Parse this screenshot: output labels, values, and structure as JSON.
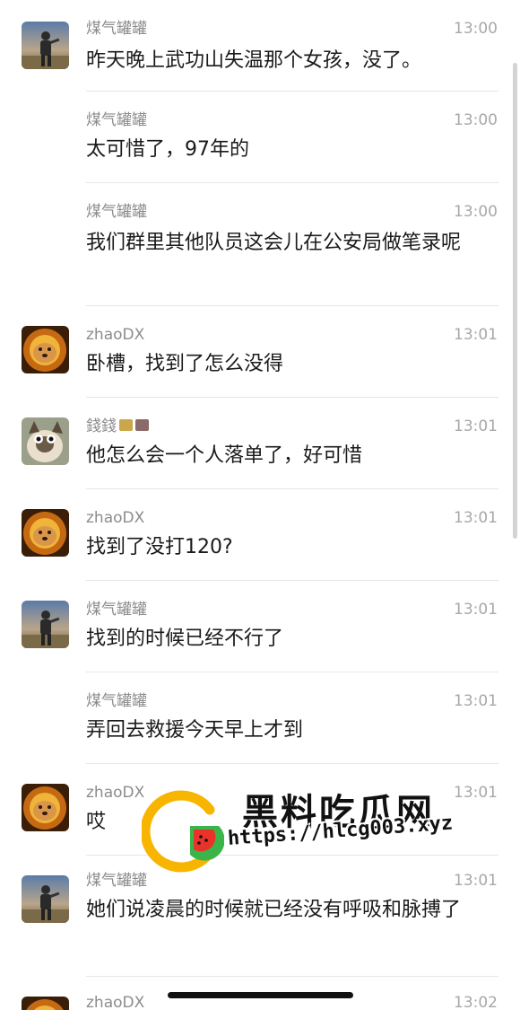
{
  "messages": [
    {
      "sender": "煤气罐罐",
      "time": "13:00",
      "text": "昨天晚上武功山失温那个女孩，没了。",
      "avatar": "hiker"
    },
    {
      "sender": "煤气罐罐",
      "time": "13:00",
      "text": "太可惜了，97年的",
      "avatar": ""
    },
    {
      "sender": "煤气罐罐",
      "time": "13:00",
      "text": "我们群里其他队员这会儿在公安局做笔录呢",
      "avatar": ""
    },
    {
      "sender": "zhaoDX",
      "time": "13:01",
      "text": "卧槽，找到了怎么没得",
      "avatar": "doge"
    },
    {
      "sender": "錢錢",
      "time": "13:01",
      "text": "他怎么会一个人落单了，好可惜",
      "avatar": "cat"
    },
    {
      "sender": "zhaoDX",
      "time": "13:01",
      "text": "找到了没打120?",
      "avatar": "doge"
    },
    {
      "sender": "煤气罐罐",
      "time": "13:01",
      "text": "找到的时候已经不行了",
      "avatar": "hiker"
    },
    {
      "sender": "煤气罐罐",
      "time": "13:01",
      "text": "弄回去救援今天早上才到",
      "avatar": ""
    },
    {
      "sender": "zhaoDX",
      "time": "13:01",
      "text": "哎",
      "avatar": "doge"
    },
    {
      "sender": "煤气罐罐",
      "time": "13:01",
      "text": "她们说凌晨的时候就已经没有呼吸和脉搏了",
      "avatar": "hiker"
    },
    {
      "sender": "zhaoDX",
      "time": "13:02",
      "text": "",
      "avatar": "doge"
    }
  ],
  "watermark": {
    "title": "黑料吃瓜网",
    "url": "https://hlcg003.xyz"
  },
  "colors": {
    "sender": "#8c8c8c",
    "time": "#a8a8a8",
    "text": "#1a1a1a",
    "divider": "#e6e6e6",
    "logo_orange": "#f7b500",
    "logo_green": "#3bb54a",
    "logo_red": "#e8322a"
  }
}
